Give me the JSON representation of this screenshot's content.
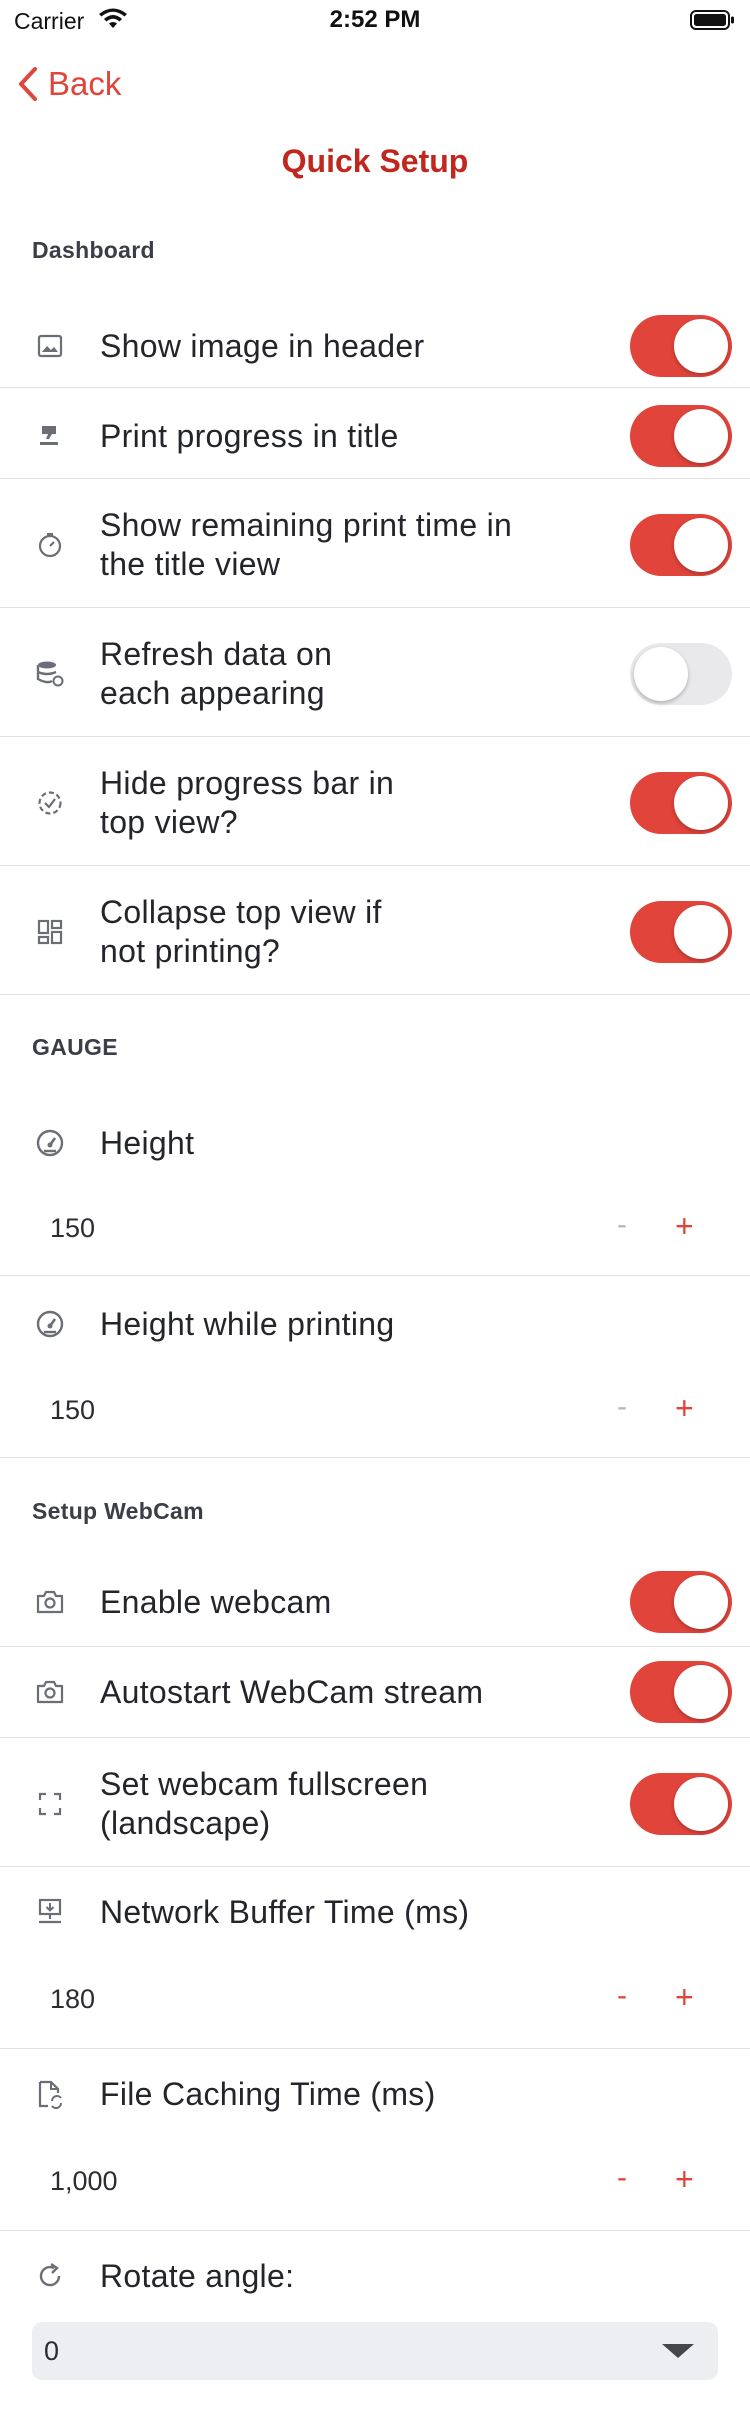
{
  "status_bar": {
    "carrier": "Carrier",
    "time": "2:52 PM"
  },
  "nav": {
    "back_label": "Back",
    "title": "Quick Setup"
  },
  "colors": {
    "accent": "#e1443b",
    "title": "#c1271d",
    "toggle_off": "#e9e9ec"
  },
  "dashboard": {
    "header": "Dashboard",
    "items": [
      {
        "label": "Show image in header",
        "icon": "image-icon",
        "on": true
      },
      {
        "label": "Print progress in title",
        "icon": "print-head-icon",
        "on": true
      },
      {
        "label": "Show remaining print time in\nthe title view",
        "icon": "timer-icon",
        "on": true
      },
      {
        "label": "Refresh data on\neach appearing",
        "icon": "database-refresh-icon",
        "on": false
      },
      {
        "label": "Hide progress bar in\ntop view?",
        "icon": "progress-check-icon",
        "on": true
      },
      {
        "label": "Collapse top view if\nnot printing?",
        "icon": "dashboard-grid-icon",
        "on": true
      }
    ]
  },
  "gauge": {
    "header": "GAUGE",
    "items": [
      {
        "label": "Height",
        "icon": "gauge-icon",
        "value": "150"
      },
      {
        "label": "Height while printing",
        "icon": "gauge-icon",
        "value": "150"
      }
    ],
    "minus": "-",
    "plus": "+"
  },
  "webcam": {
    "header": "Setup WebCam",
    "toggles": [
      {
        "label": "Enable webcam",
        "icon": "camera-icon",
        "on": true
      },
      {
        "label": "Autostart WebCam stream",
        "icon": "camera-icon",
        "on": true
      },
      {
        "label": "Set webcam fullscreen\n(landscape)",
        "icon": "fullscreen-icon",
        "on": true
      }
    ],
    "steppers": [
      {
        "label": "Network Buffer Time (ms)",
        "icon": "network-download-icon",
        "value": "180"
      },
      {
        "label": "File Caching Time (ms)",
        "icon": "file-sync-icon",
        "value": "1,000"
      }
    ],
    "rotate": {
      "label": "Rotate angle:",
      "icon": "rotate-icon",
      "selected": "0"
    }
  }
}
